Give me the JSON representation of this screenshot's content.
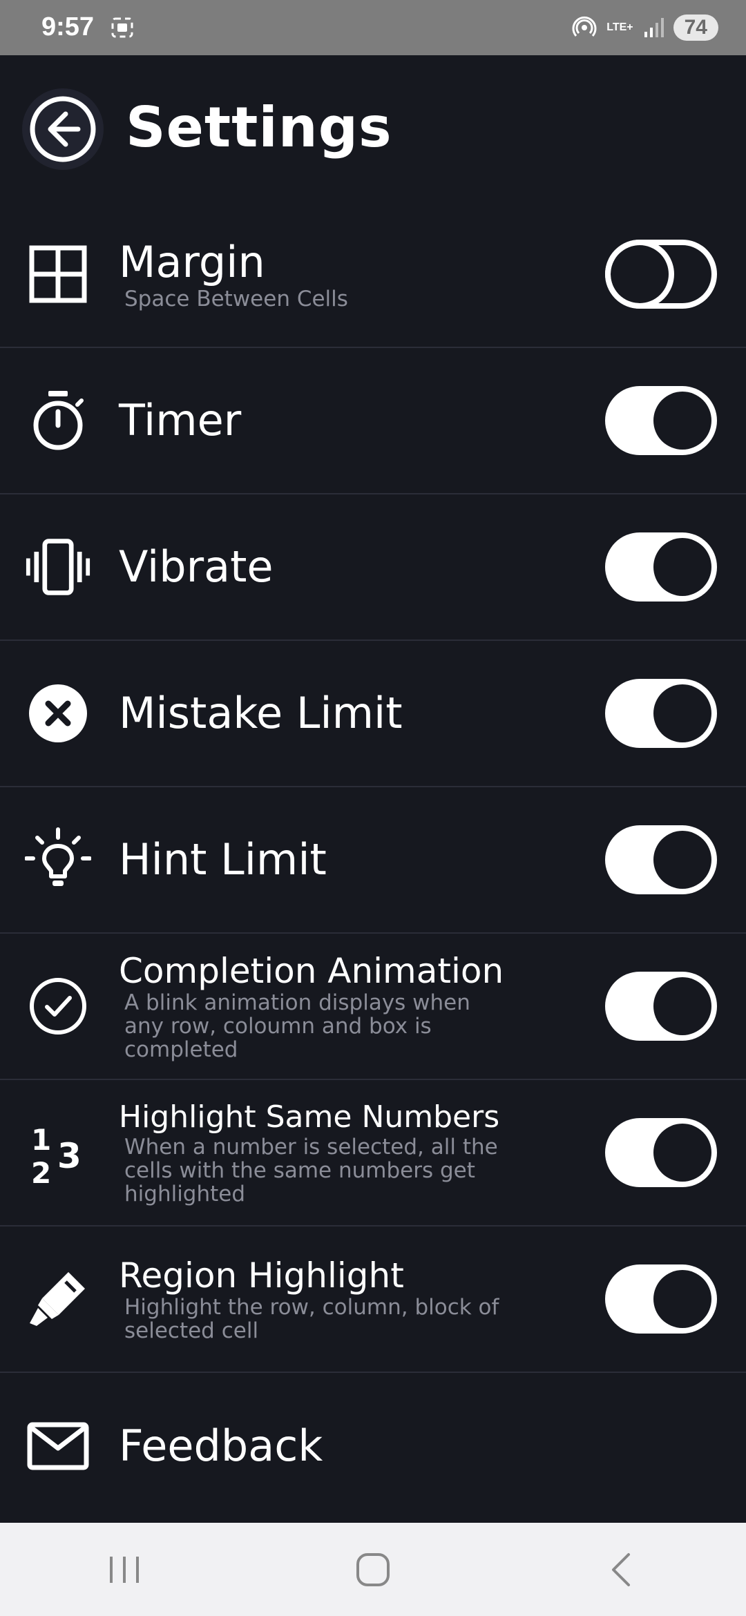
{
  "status_bar": {
    "time": "9:57",
    "network": "LTE+",
    "battery": "74"
  },
  "header": {
    "title": "Settings"
  },
  "settings": [
    {
      "title": "Margin",
      "subtitle": "Space Between Cells",
      "enabled": false,
      "icon": "grid-icon"
    },
    {
      "title": "Timer",
      "subtitle": "",
      "enabled": true,
      "icon": "stopwatch-icon"
    },
    {
      "title": "Vibrate",
      "subtitle": "",
      "enabled": true,
      "icon": "vibrate-icon"
    },
    {
      "title": "Mistake Limit",
      "subtitle": "",
      "enabled": true,
      "icon": "close-circle-icon"
    },
    {
      "title": "Hint Limit",
      "subtitle": "",
      "enabled": true,
      "icon": "lightbulb-icon"
    },
    {
      "title": "Completion Animation",
      "subtitle": "A blink animation displays when any row, coloumn and box is completed",
      "enabled": true,
      "icon": "check-circle-icon"
    },
    {
      "title": "Highlight Same Numbers",
      "subtitle": "When a number is selected, all the cells with the same numbers get highlighted",
      "enabled": true,
      "icon": "numbers-icon"
    },
    {
      "title": "Region Highlight",
      "subtitle": "Highlight the row, column, block of selected cell",
      "enabled": true,
      "icon": "highlighter-icon"
    },
    {
      "title": "Feedback",
      "subtitle": "",
      "icon": "mail-icon"
    }
  ],
  "colors": {
    "background": "#16181f",
    "divider": "#2b2d38",
    "subtitle": "#8b8d98",
    "status_bar": "#7d7d7d",
    "nav_bar": "#f1f1f3"
  }
}
